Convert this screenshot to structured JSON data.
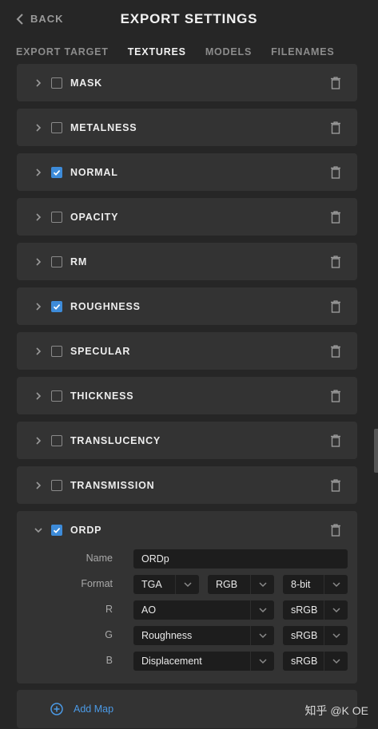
{
  "header": {
    "back_label": "BACK",
    "title": "EXPORT SETTINGS"
  },
  "tabs": [
    {
      "label": "EXPORT TARGET",
      "active": false
    },
    {
      "label": "TEXTURES",
      "active": true
    },
    {
      "label": "MODELS",
      "active": false
    },
    {
      "label": "FILENAMES",
      "active": false
    }
  ],
  "textures": [
    {
      "label": "MASK",
      "checked": false
    },
    {
      "label": "METALNESS",
      "checked": false
    },
    {
      "label": "NORMAL",
      "checked": true
    },
    {
      "label": "OPACITY",
      "checked": false
    },
    {
      "label": "RM",
      "checked": false
    },
    {
      "label": "ROUGHNESS",
      "checked": true
    },
    {
      "label": "SPECULAR",
      "checked": false
    },
    {
      "label": "THICKNESS",
      "checked": false
    },
    {
      "label": "TRANSLUCENCY",
      "checked": false
    },
    {
      "label": "TRANSMISSION",
      "checked": false
    }
  ],
  "expanded_map": {
    "label": "ORDP",
    "checked": true,
    "name_label": "Name",
    "name_value": "ORDp",
    "format_label": "Format",
    "format_type": "TGA",
    "format_channels": "RGB",
    "format_depth": "8-bit",
    "channels": [
      {
        "label": "R",
        "source": "AO",
        "colorspace": "sRGB"
      },
      {
        "label": "G",
        "source": "Roughness",
        "colorspace": "sRGB"
      },
      {
        "label": "B",
        "source": "Displacement",
        "colorspace": "sRGB"
      }
    ]
  },
  "add_map_label": "Add Map",
  "watermark": "知乎 @K OE",
  "colors": {
    "accent": "#3d8bd9",
    "background": "#262626",
    "row": "#333333",
    "field": "#1d1d1d"
  }
}
